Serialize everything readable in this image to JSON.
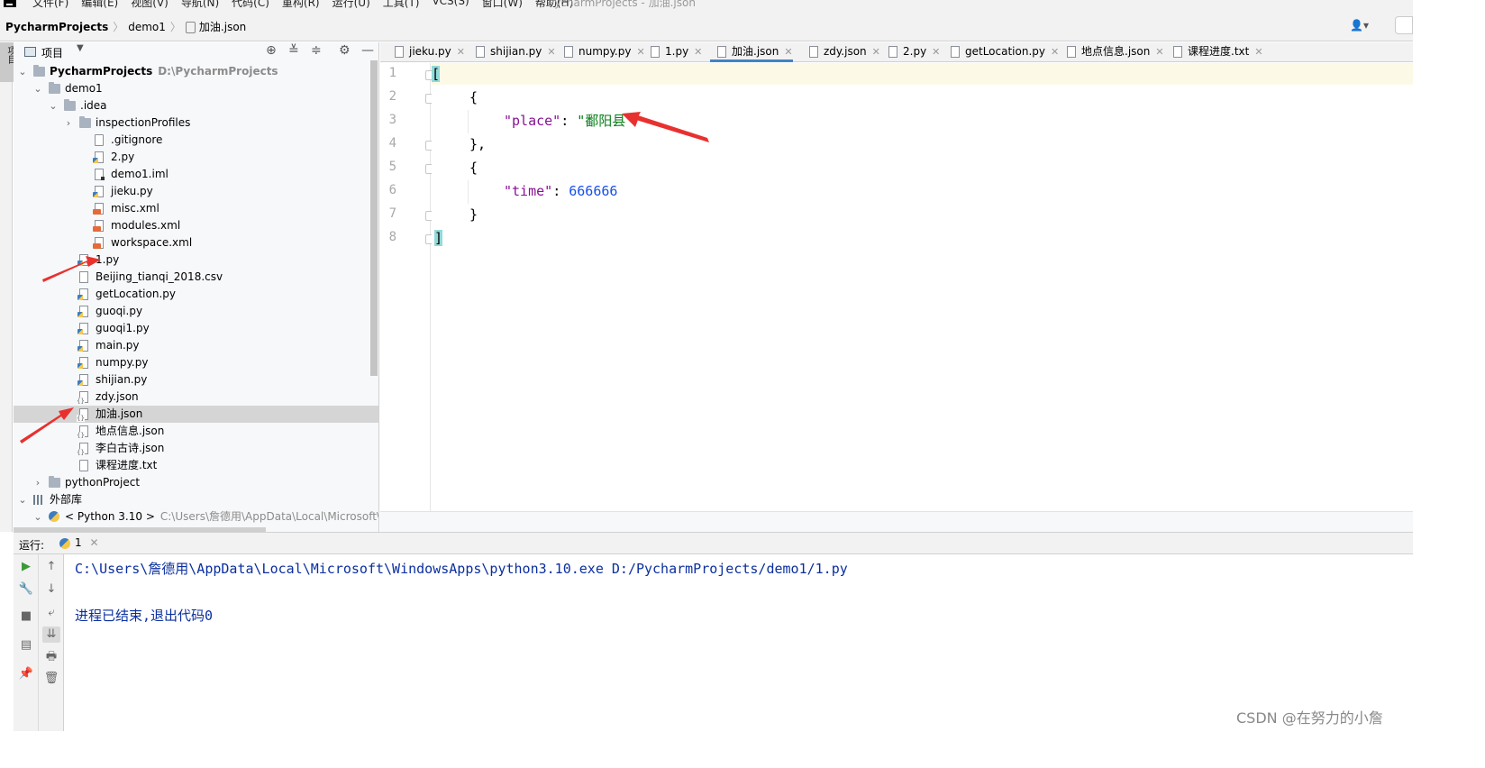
{
  "menubar": {
    "items": [
      "文件(F)",
      "编辑(E)",
      "视图(V)",
      "导航(N)",
      "代码(C)",
      "重构(R)",
      "运行(U)",
      "工具(T)",
      "VCS(S)",
      "窗口(W)",
      "帮助(H)"
    ],
    "window_title": "PycharmProjects - 加油.json"
  },
  "breadcrumb": {
    "root": "PycharmProjects",
    "folder": "demo1",
    "file": "加油.json"
  },
  "left_strip": {
    "tab_label": "项目"
  },
  "project_panel": {
    "title": "项目",
    "tree": [
      {
        "label": "PycharmProjects",
        "hint": "D:\\PycharmProjects",
        "icon": "folder-icon",
        "depth": 0,
        "arrow": "expanded",
        "bold": true
      },
      {
        "label": "demo1",
        "hint": "",
        "icon": "folder-icon",
        "depth": 1,
        "arrow": "expanded"
      },
      {
        "label": ".idea",
        "hint": "",
        "icon": "folder-icon",
        "depth": 2,
        "arrow": "expanded"
      },
      {
        "label": "inspectionProfiles",
        "hint": "",
        "icon": "folder-icon",
        "depth": 3,
        "arrow": "collapsed"
      },
      {
        "label": ".gitignore",
        "hint": "",
        "icon": "file-icon",
        "depth": 4
      },
      {
        "label": "2.py",
        "hint": "",
        "icon": "python-file-icon",
        "depth": 4
      },
      {
        "label": "demo1.iml",
        "hint": "",
        "icon": "iml-file-icon",
        "depth": 4
      },
      {
        "label": "jieku.py",
        "hint": "",
        "icon": "python-file-icon",
        "depth": 4
      },
      {
        "label": "misc.xml",
        "hint": "",
        "icon": "xml-file-icon",
        "depth": 4
      },
      {
        "label": "modules.xml",
        "hint": "",
        "icon": "xml-file-icon",
        "depth": 4
      },
      {
        "label": "workspace.xml",
        "hint": "",
        "icon": "xml-file-icon",
        "depth": 4
      },
      {
        "label": "1.py",
        "hint": "",
        "icon": "python-file-icon",
        "depth": 3
      },
      {
        "label": "Beijing_tianqi_2018.csv",
        "hint": "",
        "icon": "csv-file-icon",
        "depth": 3
      },
      {
        "label": "getLocation.py",
        "hint": "",
        "icon": "python-file-icon",
        "depth": 3
      },
      {
        "label": "guoqi.py",
        "hint": "",
        "icon": "python-file-icon",
        "depth": 3
      },
      {
        "label": "guoqi1.py",
        "hint": "",
        "icon": "python-file-icon",
        "depth": 3
      },
      {
        "label": "main.py",
        "hint": "",
        "icon": "python-file-icon",
        "depth": 3
      },
      {
        "label": "numpy.py",
        "hint": "",
        "icon": "python-file-icon",
        "depth": 3
      },
      {
        "label": "shijian.py",
        "hint": "",
        "icon": "python-file-icon",
        "depth": 3
      },
      {
        "label": "zdy.json",
        "hint": "",
        "icon": "json-file-icon",
        "depth": 3
      },
      {
        "label": "加油.json",
        "hint": "",
        "icon": "json-file-icon",
        "depth": 3,
        "selected": true
      },
      {
        "label": "地点信息.json",
        "hint": "",
        "icon": "json-file-icon",
        "depth": 3
      },
      {
        "label": "李白古诗.json",
        "hint": "",
        "icon": "json-file-icon",
        "depth": 3
      },
      {
        "label": "课程进度.txt",
        "hint": "",
        "icon": "text-file-icon",
        "depth": 3
      },
      {
        "label": "pythonProject",
        "hint": "",
        "icon": "folder-icon",
        "depth": 1,
        "arrow": "collapsed"
      },
      {
        "label": "外部库",
        "hint": "",
        "icon": "library-icon",
        "depth": 0,
        "arrow": "expanded"
      },
      {
        "label": "< Python 3.10 >",
        "hint": "C:\\Users\\詹德用\\AppData\\Local\\Microsoft\\Win",
        "icon": "python-sdk-icon",
        "depth": 1,
        "arrow": "expanded"
      }
    ]
  },
  "editor": {
    "tabs": [
      {
        "label": "jieku.py",
        "active": false
      },
      {
        "label": "shijian.py",
        "active": false
      },
      {
        "label": "numpy.py",
        "active": false
      },
      {
        "label": "1.py",
        "active": false
      },
      {
        "label": "加油.json",
        "active": true
      },
      {
        "label": "zdy.json",
        "active": false
      },
      {
        "label": "2.py",
        "active": false
      },
      {
        "label": "getLocation.py",
        "active": false
      },
      {
        "label": "地点信息.json",
        "active": false
      },
      {
        "label": "课程进度.txt",
        "active": false
      }
    ],
    "line_numbers": [
      "1",
      "2",
      "3",
      "4",
      "5",
      "6",
      "7",
      "8"
    ],
    "code": {
      "l1": "[",
      "l2": "{",
      "l3_key": "\"place\"",
      "l3_colon": ": ",
      "l3_value": "\"鄱阳县\"",
      "l4": "},",
      "l5": "{",
      "l6_key": "\"time\"",
      "l6_colon": ": ",
      "l6_value": "666666",
      "l7": "}",
      "l8": "]"
    }
  },
  "run_panel": {
    "label": "运行:",
    "tab": "1",
    "output": [
      "C:\\Users\\詹德用\\AppData\\Local\\Microsoft\\WindowsApps\\python3.10.exe D:/PycharmProjects/demo1/1.py",
      "进程已结束,退出代码0"
    ]
  },
  "watermark": "CSDN @在努力的小詹",
  "colors": {
    "keyword_purple": "#871094",
    "string_green": "#067d17",
    "number_blue": "#1750eb",
    "console_blue": "#0b2f9f",
    "annotation_red": "#e8312f",
    "tab_underline": "#4083c9"
  }
}
